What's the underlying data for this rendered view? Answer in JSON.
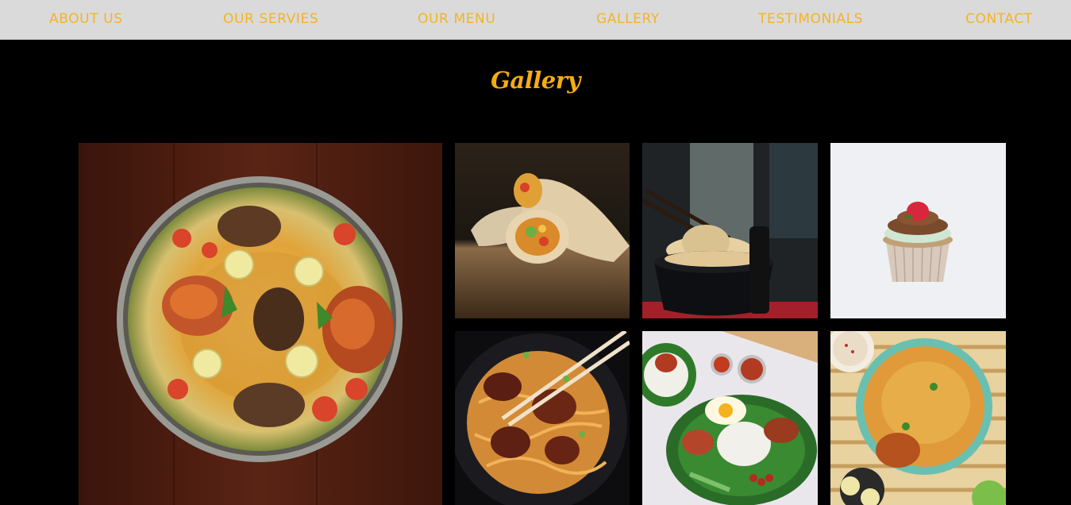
{
  "nav": {
    "items": [
      "ABOUT US",
      "OUR SERVIES",
      "OUR MENU",
      "GALLERY",
      "TESTIMONIALS",
      "CONTACT"
    ]
  },
  "gallery": {
    "title": "Gallery",
    "images": [
      "biryani-platter-photo",
      "wrap-rolls-photo",
      "noodles-chopsticks-photo",
      "cupcake-photo",
      "chicken-noodles-photo",
      "nasi-lemak-photo",
      "chicken-biryani-bowl-photo"
    ]
  },
  "colors": {
    "accent": "#f5b324",
    "nav_bg": "#dadada",
    "page_bg": "#000000"
  }
}
